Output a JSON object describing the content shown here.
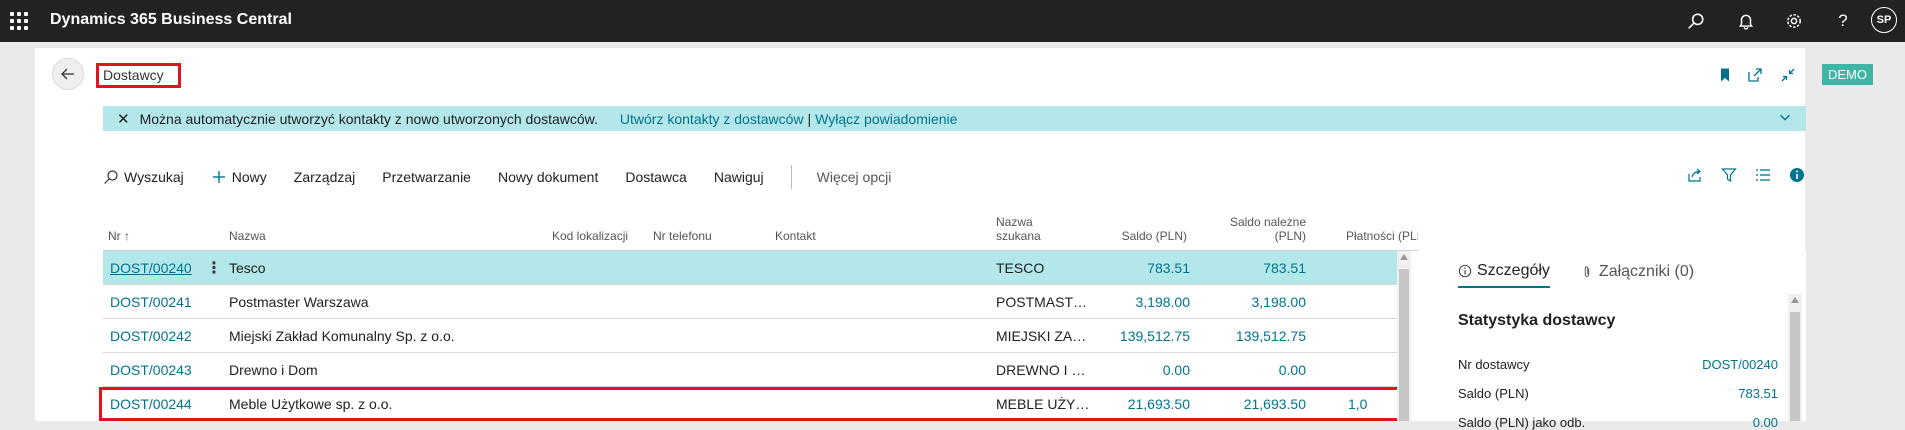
{
  "app": {
    "title": "Dynamics 365 Business Central",
    "user_initials": "SP",
    "demo_badge": "DEMO"
  },
  "page": {
    "title": "Dostawcy"
  },
  "notification": {
    "text": "Można automatycznie utworzyć kontakty z nowo utworzonych dostawców.",
    "action_create": "Utwórz kontakty z dostawców",
    "separator": "|",
    "action_disable": "Wyłącz powiadomienie"
  },
  "toolbar": {
    "search": "Wyszukaj",
    "new": "Nowy",
    "manage": "Zarządzaj",
    "process": "Przetwarzanie",
    "new_document": "Nowy dokument",
    "vendor": "Dostawca",
    "navigate": "Nawiguj",
    "more": "Więcej opcji"
  },
  "grid": {
    "columns": {
      "no": "Nr",
      "name": "Nazwa",
      "location": "Kod lokalizacji",
      "phone": "Nr telefonu",
      "contact": "Kontakt",
      "search_name_1": "Nazwa",
      "search_name_2": "szukana",
      "balance": "Saldo (PLN)",
      "balance_due_1": "Saldo należne",
      "balance_due_2": "(PLN)",
      "payments": "Płatności (PLN)"
    },
    "rows": [
      {
        "no": "DOST/00240",
        "name": "Tesco",
        "search_name": "TESCO",
        "balance": "783.51",
        "balance_due": "783.51",
        "payments": ""
      },
      {
        "no": "DOST/00241",
        "name": "Postmaster Warszawa",
        "search_name": "POSTMAST…",
        "balance": "3,198.00",
        "balance_due": "3,198.00",
        "payments": ""
      },
      {
        "no": "DOST/00242",
        "name": "Miejski Zakład Komunalny Sp. z o.o.",
        "search_name": "MIEJSKI ZA…",
        "balance": "139,512.75",
        "balance_due": "139,512.75",
        "payments": ""
      },
      {
        "no": "DOST/00243",
        "name": "Drewno i Dom",
        "search_name": "DREWNO I …",
        "balance": "0.00",
        "balance_due": "0.00",
        "payments": ""
      },
      {
        "no": "DOST/00244",
        "name": "Meble Użytkowe sp. z o.o.",
        "search_name": "MEBLE UŻY…",
        "balance": "21,693.50",
        "balance_due": "21,693.50",
        "payments": "1,0"
      }
    ]
  },
  "factbox": {
    "tab_details": "Szczegóły",
    "tab_attachments": "Załączniki (0)",
    "title": "Statystyka dostawcy",
    "rows": [
      {
        "label": "Nr dostawcy",
        "value": "DOST/00240"
      },
      {
        "label": "Saldo (PLN)",
        "value": "783.51"
      },
      {
        "label": "Saldo (PLN) jako odb.",
        "value": "0.00"
      }
    ]
  }
}
